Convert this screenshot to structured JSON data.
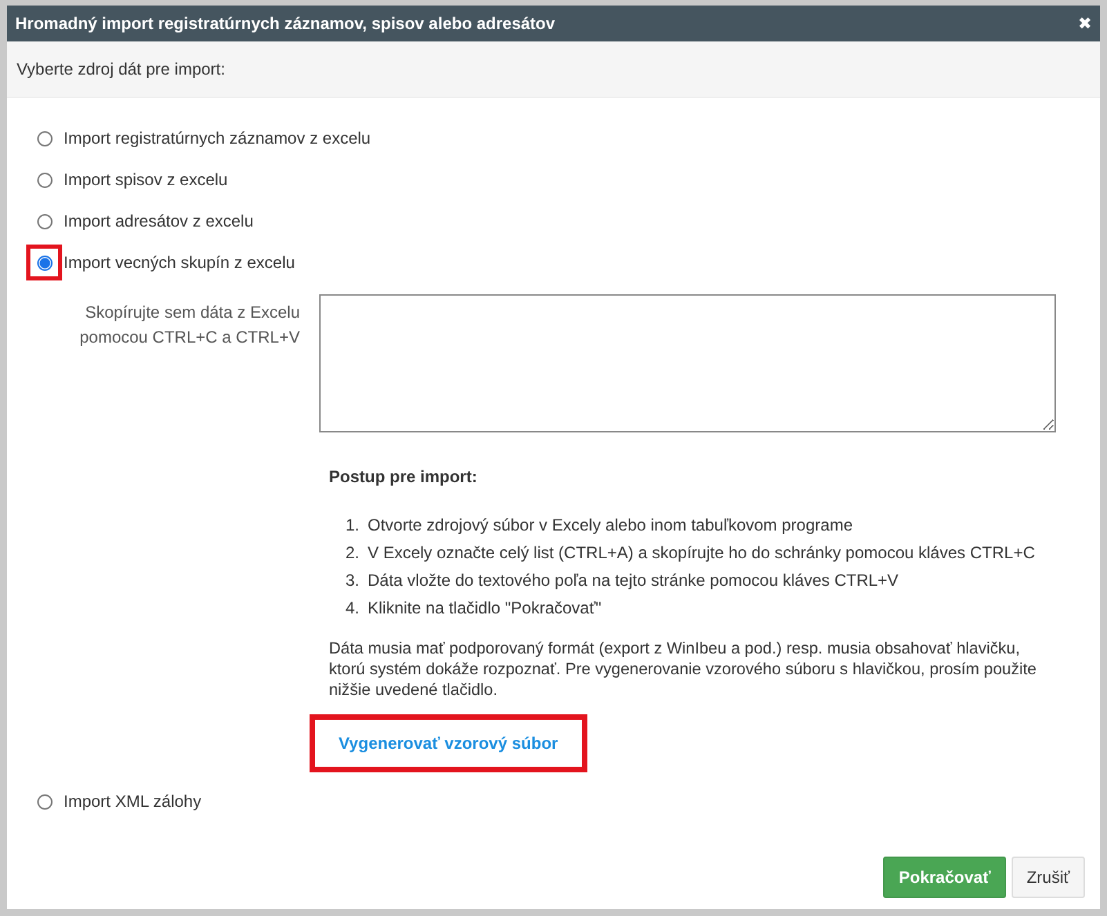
{
  "window": {
    "title": "Hromadný import registratúrnych záznamov, spisov alebo adresátov",
    "close": "✖"
  },
  "prompt": "Vyberte zdroj dát pre import:",
  "options": [
    {
      "label": "Import registratúrnych záznamov z excelu",
      "selected": false,
      "highlighted": false
    },
    {
      "label": "Import spisov z excelu",
      "selected": false,
      "highlighted": false
    },
    {
      "label": "Import adresátov z excelu",
      "selected": false,
      "highlighted": false
    },
    {
      "label": "Import vecných skupín z excelu",
      "selected": true,
      "highlighted": true,
      "details": {
        "paste_label": "Skopírujte sem dáta z Excelu pomocou CTRL+C a CTRL+V",
        "steps_title": "Postup pre import:",
        "steps": [
          {
            "number": "1.",
            "text": "Otvorte zdrojový súbor v Excely alebo inom tabuľkovom programe"
          },
          {
            "number": "2.",
            "text": "V Excely označte celý list (CTRL+A) a skopírujte ho do schránky pomocou kláves CTRL+C"
          },
          {
            "number": "3.",
            "text": "Dáta vložte do textového poľa na tejto stránke pomocou kláves CTRL+V"
          },
          {
            "number": "4.",
            "text": "Kliknite na tlačidlo \"Pokračovať\""
          }
        ],
        "note": "Dáta musia mať podporovaný formát (export z WinIbeu a pod.) resp. musia obsahovať hlavičku, ktorú systém dokáže rozpoznať. Pre vygenerovanie vzorového súboru s hlavičkou, prosím použite nižšie uvedené tlačidlo.",
        "generate": {
          "label": "Vygenerovať vzorový súbor",
          "highlighted": true
        }
      }
    },
    {
      "label": "Import XML zálohy",
      "selected": false,
      "highlighted": false
    }
  ],
  "buttons": [
    {
      "label": "Pokračovať",
      "kind": "primary"
    },
    {
      "label": "Zrušiť",
      "kind": "default"
    }
  ]
}
